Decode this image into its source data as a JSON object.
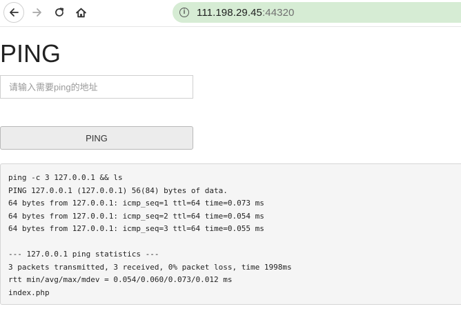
{
  "browser": {
    "url_host": "111.198.29.45",
    "url_port": ":44320",
    "accent_color": "#d6ecd4"
  },
  "page": {
    "title": "PING",
    "input": {
      "value": "",
      "placeholder": "请输入需要ping的地址"
    },
    "button_label": "PING",
    "output_lines": [
      "ping -c 3 127.0.0.1 && ls",
      "PING 127.0.0.1 (127.0.0.1) 56(84) bytes of data.",
      "64 bytes from 127.0.0.1: icmp_seq=1 ttl=64 time=0.073 ms",
      "64 bytes from 127.0.0.1: icmp_seq=2 ttl=64 time=0.054 ms",
      "64 bytes from 127.0.0.1: icmp_seq=3 ttl=64 time=0.055 ms",
      "",
      "--- 127.0.0.1 ping statistics ---",
      "3 packets transmitted, 3 received, 0% packet loss, time 1998ms",
      "rtt min/avg/max/mdev = 0.054/0.060/0.073/0.012 ms",
      "index.php"
    ]
  }
}
